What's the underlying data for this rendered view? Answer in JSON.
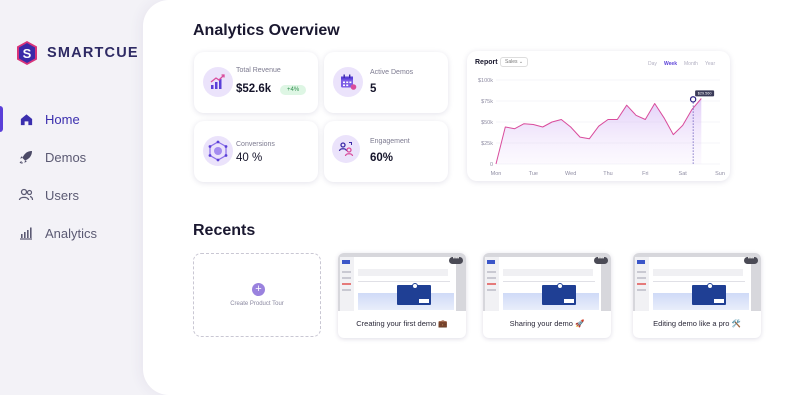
{
  "brand": {
    "name": "SMARTCUE",
    "logo_letter": "S"
  },
  "sidebar": {
    "items": [
      {
        "label": "Home",
        "icon": "home-icon",
        "active": true
      },
      {
        "label": "Demos",
        "icon": "rocket-icon",
        "active": false
      },
      {
        "label": "Users",
        "icon": "users-icon",
        "active": false
      },
      {
        "label": "Analytics",
        "icon": "analytics-icon",
        "active": false
      }
    ]
  },
  "overview": {
    "title": "Analytics Overview",
    "stats": {
      "revenue": {
        "label": "Total Revenue",
        "value": "$52.6k",
        "change": "+4%",
        "icon": "revenue-chart-icon"
      },
      "demos": {
        "label": "Active Demos",
        "value": "5",
        "icon": "calendar-icon"
      },
      "conversions": {
        "label": "Conversions",
        "value": "40 %",
        "icon": "hexagon-network-icon"
      },
      "engagement": {
        "label": "Engagement",
        "value": "60%",
        "icon": "engagement-users-icon"
      }
    },
    "report": {
      "title": "Report",
      "select_value": "Sales",
      "periods": [
        "Day",
        "Week",
        "Month",
        "Year"
      ],
      "active_period": "Week",
      "tooltip": "$29.560"
    }
  },
  "chart_data": {
    "type": "line",
    "title": "Report",
    "categories": [
      "Mon",
      "Tue",
      "Wed",
      "Thu",
      "Fri",
      "Sat",
      "Sun"
    ],
    "y_tick_labels": [
      "0",
      "$25k",
      "$50k",
      "$75k",
      "$100k"
    ],
    "ylim": [
      0,
      100
    ],
    "x": [
      0,
      0.25,
      0.5,
      0.75,
      1.0,
      1.25,
      1.5,
      1.75,
      2.0,
      2.25,
      2.5,
      2.75,
      3.0,
      3.25,
      3.5,
      3.75,
      4.0,
      4.25,
      4.5,
      4.75,
      5.0,
      5.25,
      5.5
    ],
    "series": [
      {
        "values": [
          0,
          44,
          42,
          48,
          47,
          44,
          50,
          53,
          44,
          32,
          30,
          45,
          53,
          53,
          70,
          58,
          53,
          72,
          55,
          35,
          46,
          65,
          78
        ]
      }
    ],
    "highlight": {
      "x": 5.28,
      "y": 77,
      "label": "$29.560"
    },
    "grid": true,
    "line_color": "#d94c9c"
  },
  "recents": {
    "title": "Recents",
    "create_label": "Create Product Tour",
    "more_label": "•••",
    "demos": [
      {
        "title": "Creating your first demo 💼"
      },
      {
        "title": "Sharing your demo 🚀"
      },
      {
        "title": "Editing demo like a pro 🛠️"
      }
    ]
  },
  "colors": {
    "accent": "#5a3fd8",
    "brand_text": "#2e2a64",
    "chart_line": "#d94c9c",
    "background": "#f3f2f7"
  }
}
